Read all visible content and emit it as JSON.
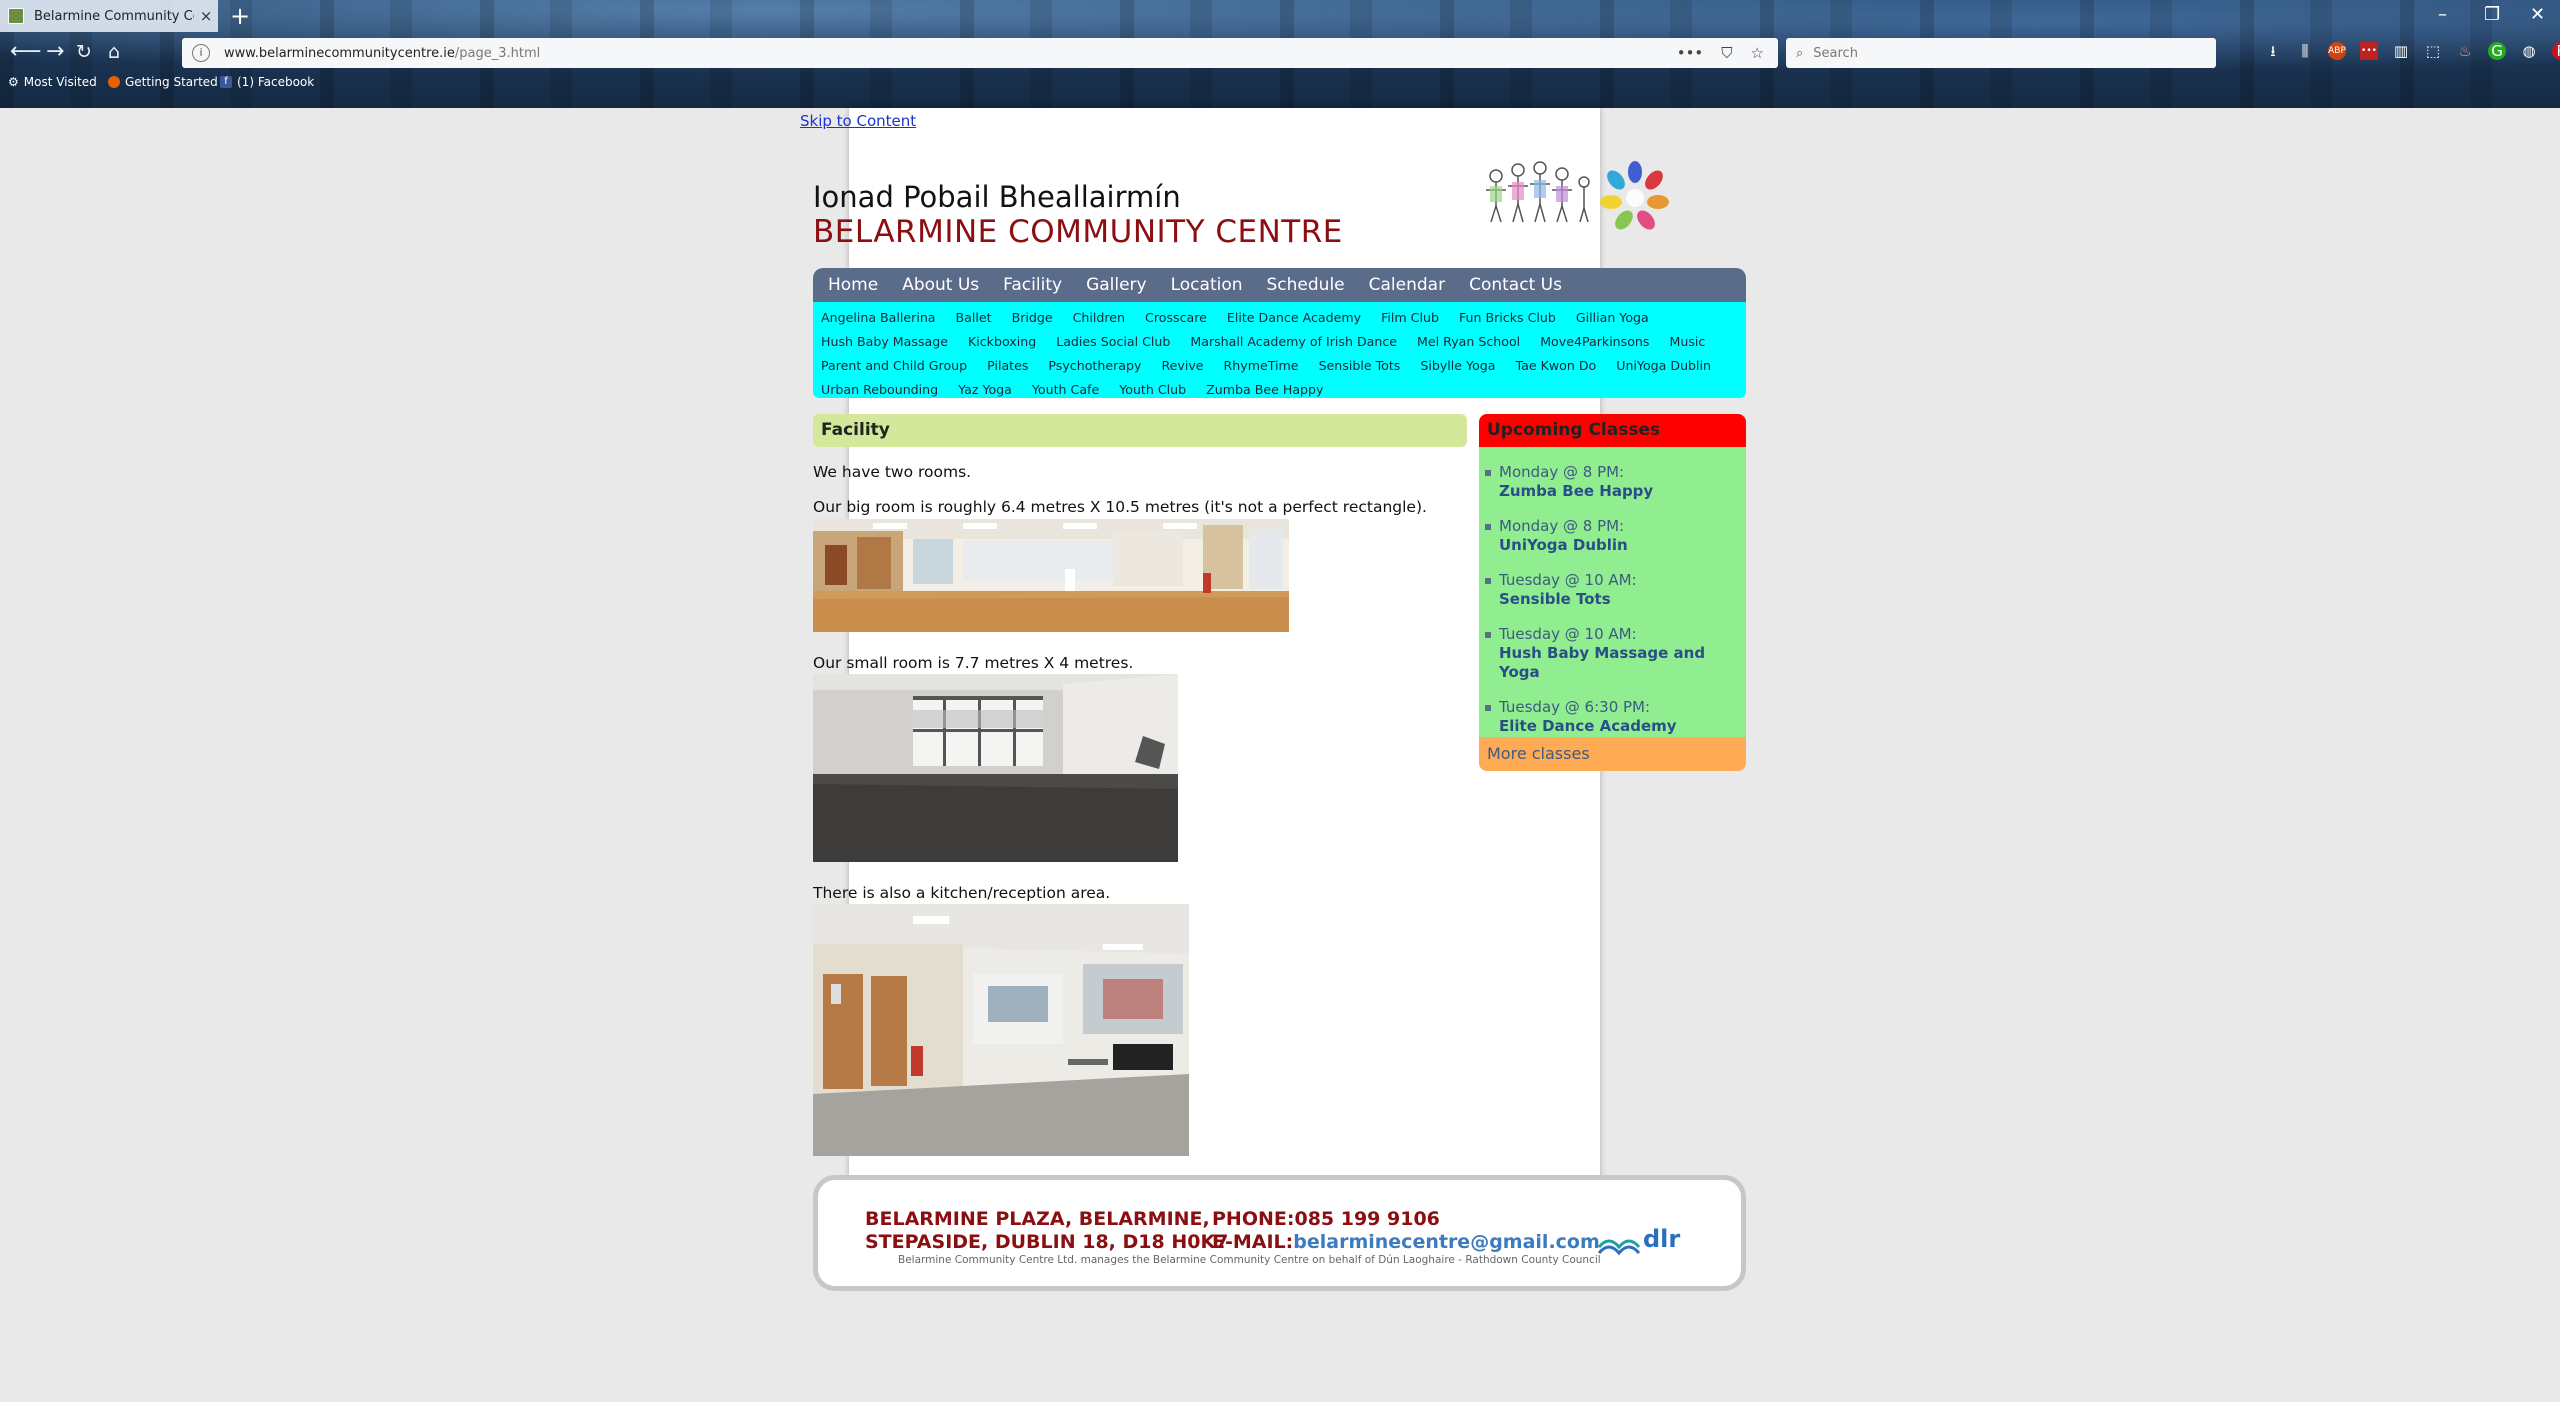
{
  "browser": {
    "tab_title": "Belarmine Community Centre",
    "tab_close": "×",
    "new_tab": "+",
    "url_domain": "www.belarminecommunitycentre.ie",
    "url_path": "/page_3.html",
    "url_actions": [
      "•••",
      "⛉",
      "☆"
    ],
    "search_placeholder": "Search",
    "bookmarks": [
      "Most Visited",
      "Getting Started",
      "(1) Facebook"
    ]
  },
  "page": {
    "skip_link": "Skip to Content",
    "title_irish": "Ionad Pobail Bheallairmín",
    "title_english": "BELARMINE COMMUNITY CENTRE",
    "main_nav": [
      "Home",
      "About Us",
      "Facility",
      "Gallery",
      "Location",
      "Schedule",
      "Calendar",
      "Contact Us"
    ],
    "sub_nav": [
      "Angelina Ballerina",
      "Ballet",
      "Bridge",
      "Children",
      "Crosscare",
      "Elite Dance Academy",
      "Film Club",
      "Fun Bricks Club",
      "Gillian Yoga",
      "Hush Baby Massage",
      "Kickboxing",
      "Ladies Social Club",
      "Marshall Academy of Irish Dance",
      "Mel Ryan School",
      "Move4Parkinsons",
      "Music",
      "Parent and Child Group",
      "Pilates",
      "Psychotherapy",
      "Revive",
      "RhymeTime",
      "Sensible Tots",
      "Sibylle Yoga",
      "Tae Kwon Do",
      "UniYoga Dublin",
      "Urban Rebounding",
      "Yaz Yoga",
      "Youth Cafe",
      "Youth Club",
      "Zumba Bee Happy"
    ],
    "section_heading": "Facility",
    "para_rooms": "We have two rooms.",
    "para_big_room": "Our big room is roughly 6.4 metres X 10.5 metres (it's not a perfect rectangle).",
    "para_small_room": "Our small room is 7.7 metres X 4 metres.",
    "para_kitchen": "There is also a kitchen/reception area.",
    "upcoming_heading": "Upcoming Classes",
    "classes": [
      {
        "when": "Monday @ 8 PM:",
        "name": "Zumba Bee Happy"
      },
      {
        "when": "Monday @ 8 PM:",
        "name": "UniYoga Dublin"
      },
      {
        "when": "Tuesday @ 10 AM:",
        "name": "Sensible Tots"
      },
      {
        "when": "Tuesday @ 10 AM:",
        "name": "Hush Baby Massage and Yoga"
      },
      {
        "when": "Tuesday @ 6:30 PM:",
        "name": "Elite Dance Academy"
      }
    ],
    "more_classes": "More classes",
    "footer": {
      "address_line1": "BELARMINE PLAZA, BELARMINE,",
      "address_line2": "STEPASIDE, DUBLIN 18, D18 H0K7",
      "phone_label": "PHONE:",
      "phone": "085 199 9106",
      "email_label": "E-MAIL:",
      "email": "belarminecentre@gmail.com",
      "note": "Belarmine Community Centre Ltd. manages the Belarmine Community Centre on behalf of Dún Laoghaire - Rathdown County Council",
      "dlr_logo_text": "dlr"
    }
  },
  "colors": {
    "title_red": "#8b0e11",
    "nav_bg": "#5b6b8a",
    "subnav_bg": "#00ffff",
    "facility_head_bg": "#d3e89a",
    "upcoming_head_bg": "#ff0000",
    "upcoming_body_bg": "#90ee90",
    "more_bg": "#ffaa55"
  }
}
